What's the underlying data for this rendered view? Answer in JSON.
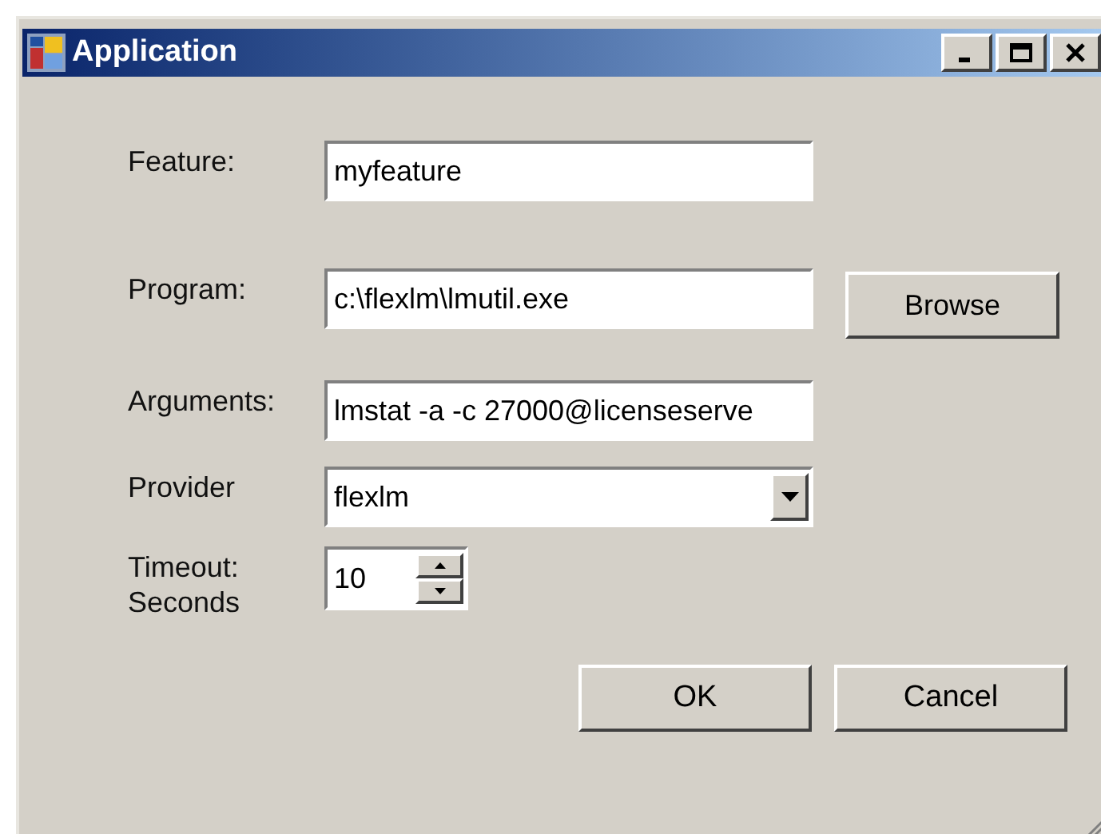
{
  "window": {
    "title": "Application"
  },
  "fields": [
    {
      "label": "Feature:",
      "kind": "text",
      "value": "myfeature"
    },
    {
      "label": "Program:",
      "kind": "text",
      "value": "c:\\flexlm\\lmutil.exe",
      "button": "Browse"
    },
    {
      "label": "Arguments:",
      "kind": "text",
      "value": "lmstat -a -c 27000@licenseserve"
    },
    {
      "label": "Provider",
      "kind": "dropdown",
      "value": "flexlm"
    },
    {
      "label": "Timeout:\nSeconds",
      "kind": "spinner",
      "value": "10"
    }
  ],
  "buttons": [
    "OK",
    "Cancel"
  ]
}
